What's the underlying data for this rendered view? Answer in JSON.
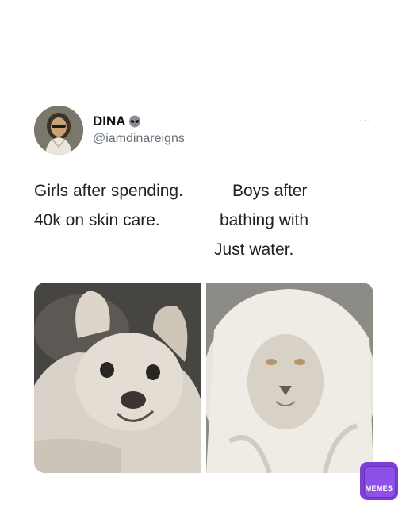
{
  "tweet": {
    "display_name": "DINA",
    "name_emoji": "alien-emoji",
    "handle": "@iamdinareigns",
    "more_label": "···"
  },
  "caption": {
    "left_line1": "Girls after spending.",
    "left_line2": "40k on skin care.",
    "right_line1": "Boys after",
    "right_line2": "bathing with",
    "right_line3": "Just water."
  },
  "images": {
    "left": "dog-photo",
    "right": "white-lion-photo"
  },
  "watermark": {
    "label": "MEMES",
    "color": "#7d3fd4"
  }
}
